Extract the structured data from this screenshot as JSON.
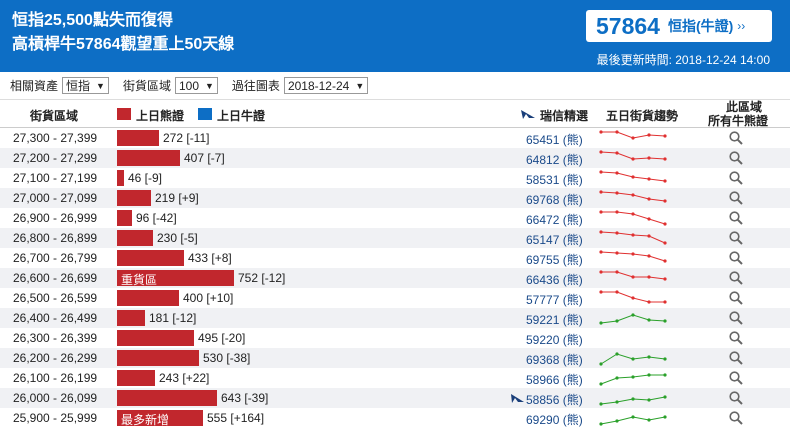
{
  "header": {
    "title_line1": "恒指25,500點失而復得",
    "title_line2": "高槓桿牛57864觀望重上50天線",
    "warrant_code": "57864",
    "warrant_name": "恒指(牛證)",
    "warrant_chevron_icon": "chevron-right-icon",
    "updated": "最後更新時間: 2018-12-24 14:00"
  },
  "filters": {
    "asset_label": "相關資產",
    "asset_value": "恒指",
    "zone_label": "街貨區域",
    "zone_value": "100",
    "history_label": "過往圖表",
    "history_value": "2018-12-24"
  },
  "columns": {
    "range": "街貨區域",
    "bear_legend": "上日熊證",
    "bull_legend": "上日牛證",
    "ubs": "瑞信精選",
    "trend": "五日街貨趨勢",
    "all_line1": "此區域",
    "all_line2": "所有牛熊證"
  },
  "colors": {
    "brand": "#0d6ec5",
    "bear": "#c1272d",
    "bull": "#0d6ec5",
    "trend_down": "#e03030",
    "trend_up": "#2aa02a"
  },
  "rows": [
    {
      "range": "27,300 - 27,399",
      "value": 272,
      "label": "272 [-11]",
      "tag": "",
      "code": "65451 (熊)",
      "ubs": false,
      "trend": "down",
      "spark": [
        3,
        3,
        9,
        6,
        7
      ]
    },
    {
      "range": "27,200 - 27,299",
      "value": 407,
      "label": "407 [-7]",
      "tag": "",
      "code": "64812 (熊)",
      "ubs": false,
      "trend": "down",
      "spark": [
        3,
        4,
        10,
        9,
        10
      ]
    },
    {
      "range": "27,100 - 27,199",
      "value": 46,
      "label": "46 [-9]",
      "tag": "",
      "code": "58531 (熊)",
      "ubs": false,
      "trend": "down",
      "spark": [
        3,
        4,
        8,
        10,
        12
      ]
    },
    {
      "range": "27,000 - 27,099",
      "value": 219,
      "label": "219 [+9]",
      "tag": "",
      "code": "69768 (熊)",
      "ubs": false,
      "trend": "down",
      "spark": [
        3,
        4,
        6,
        10,
        12
      ]
    },
    {
      "range": "26,900 - 26,999",
      "value": 96,
      "label": "96 [-42]",
      "tag": "",
      "code": "66472 (熊)",
      "ubs": false,
      "trend": "down",
      "spark": [
        3,
        3,
        5,
        10,
        15
      ]
    },
    {
      "range": "26,800 - 26,899",
      "value": 230,
      "label": "230 [-5]",
      "tag": "",
      "code": "65147 (熊)",
      "ubs": false,
      "trend": "down",
      "spark": [
        3,
        4,
        6,
        7,
        14
      ]
    },
    {
      "range": "26,700 - 26,799",
      "value": 433,
      "label": "433 [+8]",
      "tag": "",
      "code": "69755 (熊)",
      "ubs": false,
      "trend": "down",
      "spark": [
        3,
        4,
        5,
        7,
        12
      ]
    },
    {
      "range": "26,600 - 26,699",
      "value": 752,
      "label": "752 [-12]",
      "tag": "重貨區",
      "code": "66436 (熊)",
      "ubs": false,
      "trend": "down",
      "spark": [
        3,
        3,
        8,
        8,
        10
      ]
    },
    {
      "range": "26,500 - 26,599",
      "value": 400,
      "label": "400 [+10]",
      "tag": "",
      "code": "57777 (熊)",
      "ubs": false,
      "trend": "down",
      "spark": [
        3,
        3,
        9,
        13,
        13
      ]
    },
    {
      "range": "26,400 - 26,499",
      "value": 181,
      "label": "181 [-12]",
      "tag": "",
      "code": "59221 (熊)",
      "ubs": false,
      "trend": "up",
      "spark": [
        14,
        12,
        6,
        11,
        12
      ]
    },
    {
      "range": "26,300 - 26,399",
      "value": 495,
      "label": "495 [-20]",
      "tag": "",
      "code": "59220 (熊)",
      "ubs": false,
      "trend": "none",
      "spark": []
    },
    {
      "range": "26,200 - 26,299",
      "value": 530,
      "label": "530 [-38]",
      "tag": "",
      "code": "69368 (熊)",
      "ubs": false,
      "trend": "up",
      "spark": [
        15,
        5,
        10,
        8,
        10
      ]
    },
    {
      "range": "26,100 - 26,199",
      "value": 243,
      "label": "243 [+22]",
      "tag": "",
      "code": "58966 (熊)",
      "ubs": false,
      "trend": "up",
      "spark": [
        15,
        9,
        8,
        6,
        6
      ]
    },
    {
      "range": "26,000 - 26,099",
      "value": 643,
      "label": "643 [-39]",
      "tag": "",
      "code": "58856 (熊)",
      "ubs": true,
      "trend": "up",
      "spark": [
        15,
        13,
        10,
        11,
        8
      ]
    },
    {
      "range": "25,900 - 25,999",
      "value": 555,
      "label": "555 [+164]",
      "tag": "最多新增",
      "code": "69290 (熊)",
      "ubs": false,
      "trend": "up",
      "spark": [
        15,
        12,
        8,
        11,
        8
      ]
    }
  ]
}
